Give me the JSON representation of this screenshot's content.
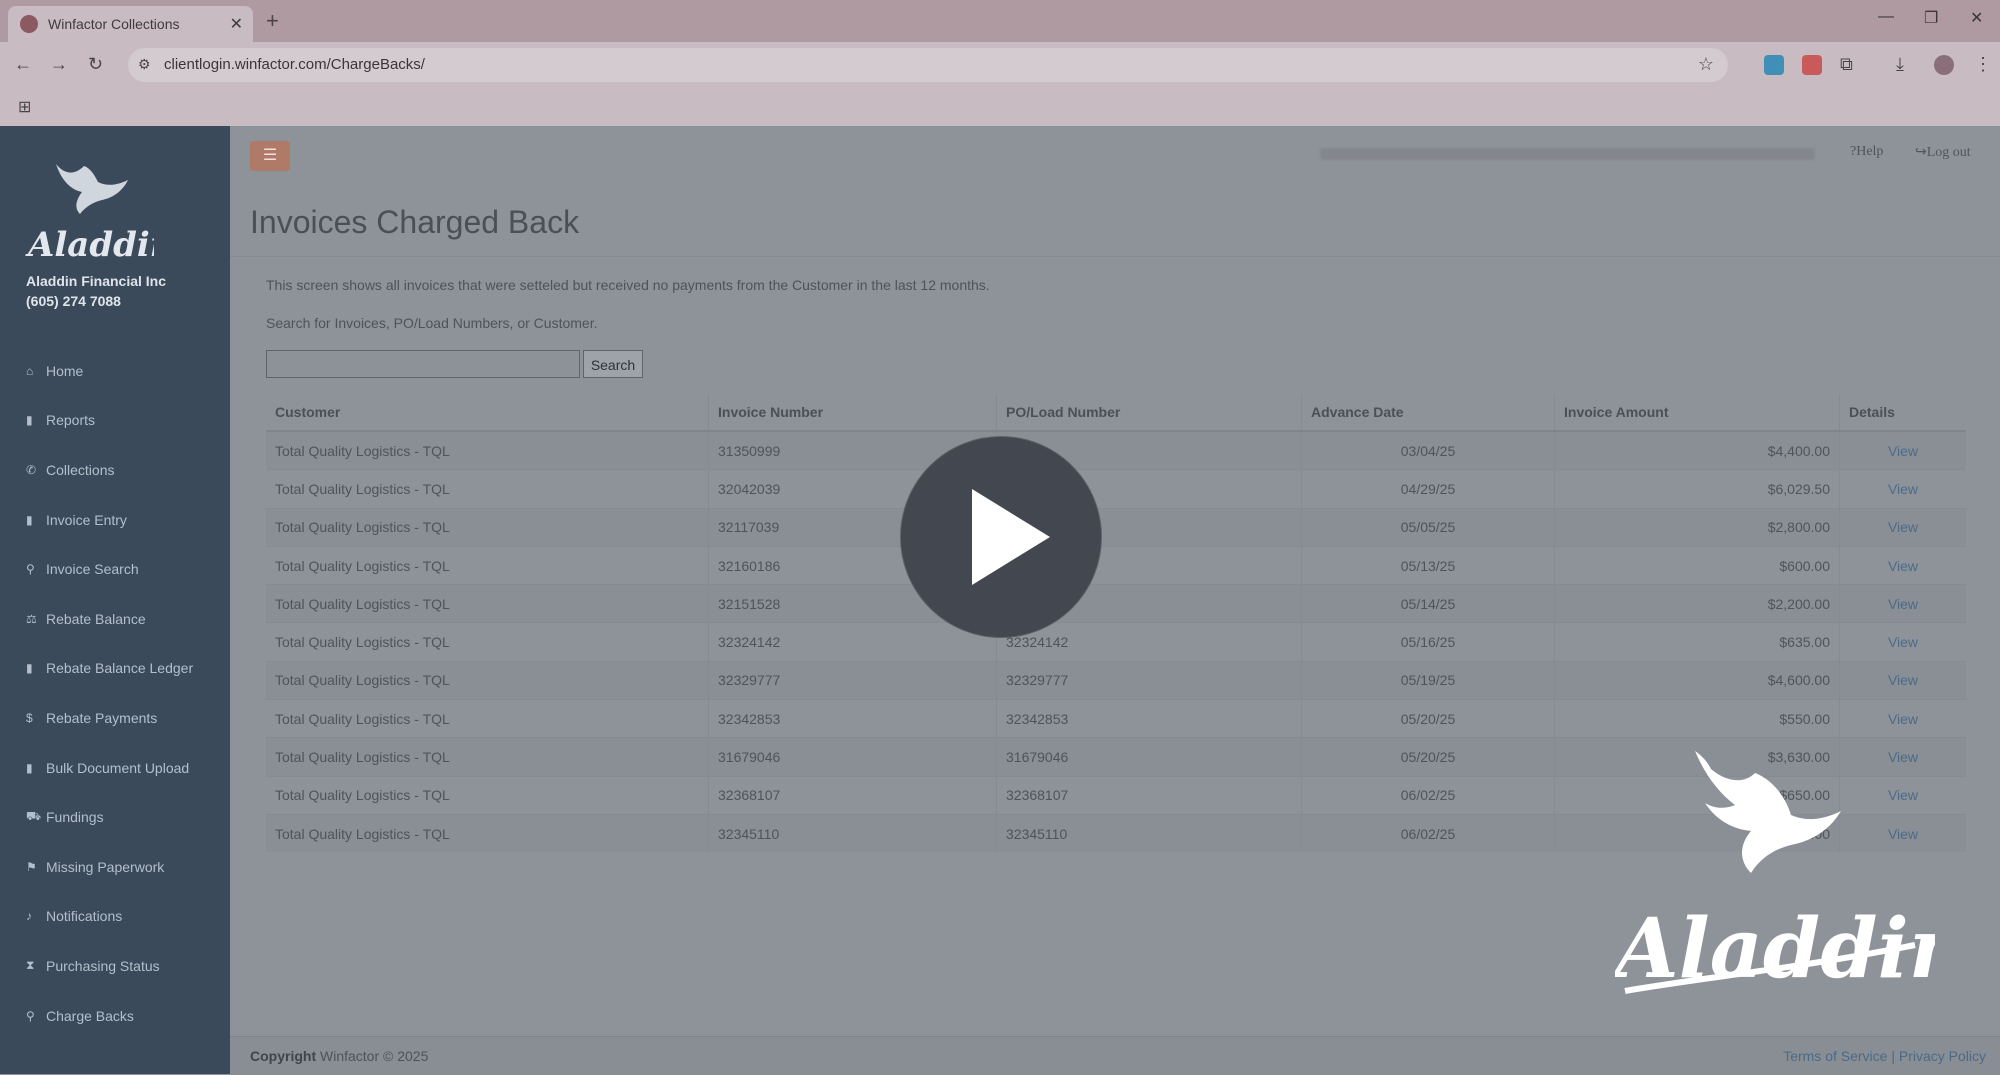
{
  "browser": {
    "tab_title": "Winfactor Collections",
    "new_tab": "+",
    "close_tab": "✕",
    "url": "clientlogin.winfactor.com/ChargeBacks/",
    "window_controls": [
      "—",
      "❐",
      "✕"
    ]
  },
  "sidebar": {
    "logo_text": "Aladdin",
    "company_name": "Aladdin Financial Inc",
    "company_phone": "(605) 274 7088",
    "items": [
      {
        "label": "Home",
        "icon": "home-icon",
        "glyph": "⌂"
      },
      {
        "label": "Reports",
        "icon": "document-icon",
        "glyph": "▮"
      },
      {
        "label": "Collections",
        "icon": "phone-icon",
        "glyph": "✆"
      },
      {
        "label": "Invoice Entry",
        "icon": "document-icon",
        "glyph": "▮"
      },
      {
        "label": "Invoice Search",
        "icon": "search-icon",
        "glyph": "⚲"
      },
      {
        "label": "Rebate Balance",
        "icon": "balance-icon",
        "glyph": "⚖"
      },
      {
        "label": "Rebate Balance Ledger",
        "icon": "book-icon",
        "glyph": "▮"
      },
      {
        "label": "Rebate Payments",
        "icon": "dollar-icon",
        "glyph": "$"
      },
      {
        "label": "Bulk Document Upload",
        "icon": "file-icon",
        "glyph": "▮"
      },
      {
        "label": "Fundings",
        "icon": "truck-icon",
        "glyph": "⛟"
      },
      {
        "label": "Missing Paperwork",
        "icon": "flag-icon",
        "glyph": "⚑"
      },
      {
        "label": "Notifications",
        "icon": "bell-icon",
        "glyph": "♪"
      },
      {
        "label": "Purchasing Status",
        "icon": "hourglass-icon",
        "glyph": "⧗"
      },
      {
        "label": "Charge Backs",
        "icon": "pin-icon",
        "glyph": "⚲"
      }
    ]
  },
  "header": {
    "help": "Help",
    "logout": "Log out"
  },
  "main": {
    "title": "Invoices Charged Back",
    "description": "This screen shows all invoices that were setteled but received no payments from the Customer in the last 12 months.",
    "search_hint": "Search for Invoices, PO/Load Numbers, or Customer.",
    "search_button": "Search",
    "search_value": ""
  },
  "table": {
    "columns": [
      "Customer",
      "Invoice Number",
      "PO/Load Number",
      "Advance Date",
      "Invoice Amount",
      "Details"
    ],
    "rows": [
      {
        "customer": "Total Quality Logistics - TQL",
        "invoice": "31350999",
        "po": "",
        "date": "03/04/25",
        "amount": "$4,400.00",
        "details": "View"
      },
      {
        "customer": "Total Quality Logistics - TQL",
        "invoice": "32042039",
        "po": "",
        "date": "04/29/25",
        "amount": "$6,029.50",
        "details": "View"
      },
      {
        "customer": "Total Quality Logistics - TQL",
        "invoice": "32117039",
        "po": "",
        "date": "05/05/25",
        "amount": "$2,800.00",
        "details": "View"
      },
      {
        "customer": "Total Quality Logistics - TQL",
        "invoice": "32160186",
        "po": "",
        "date": "05/13/25",
        "amount": "$600.00",
        "details": "View"
      },
      {
        "customer": "Total Quality Logistics - TQL",
        "invoice": "32151528",
        "po": "",
        "date": "05/14/25",
        "amount": "$2,200.00",
        "details": "View"
      },
      {
        "customer": "Total Quality Logistics - TQL",
        "invoice": "32324142",
        "po": "32324142",
        "date": "05/16/25",
        "amount": "$635.00",
        "details": "View"
      },
      {
        "customer": "Total Quality Logistics - TQL",
        "invoice": "32329777",
        "po": "32329777",
        "date": "05/19/25",
        "amount": "$4,600.00",
        "details": "View"
      },
      {
        "customer": "Total Quality Logistics - TQL",
        "invoice": "32342853",
        "po": "32342853",
        "date": "05/20/25",
        "amount": "$550.00",
        "details": "View"
      },
      {
        "customer": "Total Quality Logistics - TQL",
        "invoice": "31679046",
        "po": "31679046",
        "date": "05/20/25",
        "amount": "$3,630.00",
        "details": "View"
      },
      {
        "customer": "Total Quality Logistics - TQL",
        "invoice": "32368107",
        "po": "32368107",
        "date": "06/02/25",
        "amount": "$650.00",
        "details": "View"
      },
      {
        "customer": "Total Quality Logistics - TQL",
        "invoice": "32345110",
        "po": "32345110",
        "date": "06/02/25",
        "amount": "$550.00",
        "details": "View"
      }
    ]
  },
  "footer": {
    "copyright_label": "Copyright",
    "copyright_text": "Winfactor © 2025",
    "terms": "Terms of Service",
    "separator": "|",
    "privacy": "Privacy Policy"
  },
  "overlay": {
    "play_icon": "play-icon",
    "watermark_text": "Aladdin"
  },
  "colors": {
    "sidebar": "#3b4a5a",
    "toggle": "#b07a68",
    "link": "#4a6a88"
  }
}
